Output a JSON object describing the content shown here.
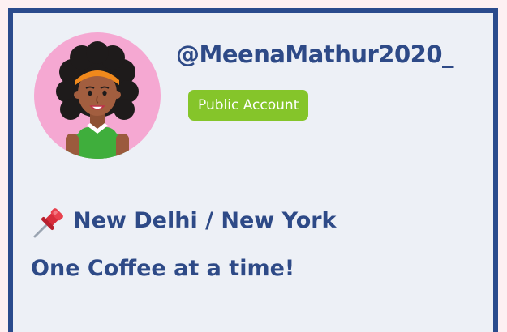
{
  "profile": {
    "handle": "@MeenaMathur2020_",
    "account_type": "Public Account",
    "location": "New Delhi / New York",
    "bio": "One Coffee at a time!"
  },
  "icons": {
    "avatar": "woman-avatar",
    "location": "pushpin-icon"
  },
  "colors": {
    "frame": "#2a4b8d",
    "text": "#2e4a87",
    "badge": "#85c52a",
    "avatar_bg": "#f5a8d2"
  }
}
